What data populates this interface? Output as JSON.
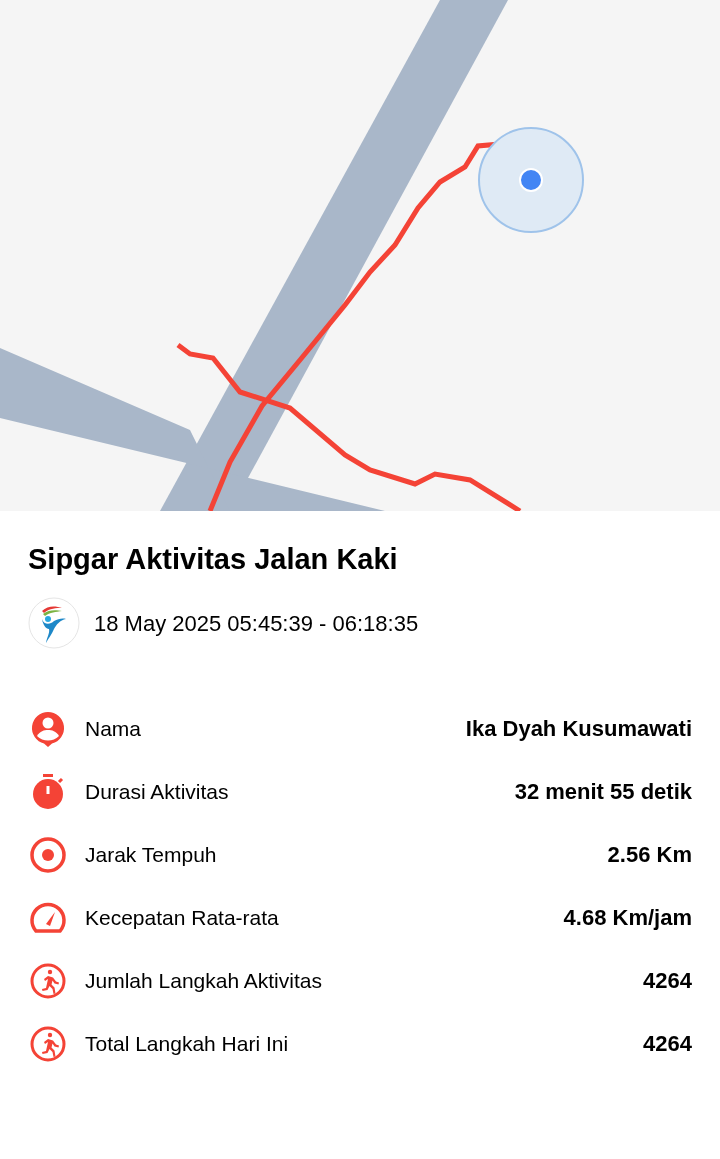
{
  "title": "Sipgar Aktivitas Jalan Kaki",
  "datetime": "18 May 2025 05:45:39 - 06:18:35",
  "stats": [
    {
      "kind": "person",
      "label": "Nama",
      "value": "Ika Dyah Kusumawati"
    },
    {
      "kind": "timer",
      "label": "Durasi Aktivitas",
      "value": "32 menit 55 detik"
    },
    {
      "kind": "target",
      "label": "Jarak Tempuh",
      "value": "2.56 Km"
    },
    {
      "kind": "speed",
      "label": "Kecepatan Rata-rata",
      "value": "4.68 Km/jam"
    },
    {
      "kind": "walk",
      "label": "Jumlah Langkah Aktivitas",
      "value": "4264"
    },
    {
      "kind": "walk",
      "label": "Total Langkah Hari Ini",
      "value": "4264"
    }
  ]
}
